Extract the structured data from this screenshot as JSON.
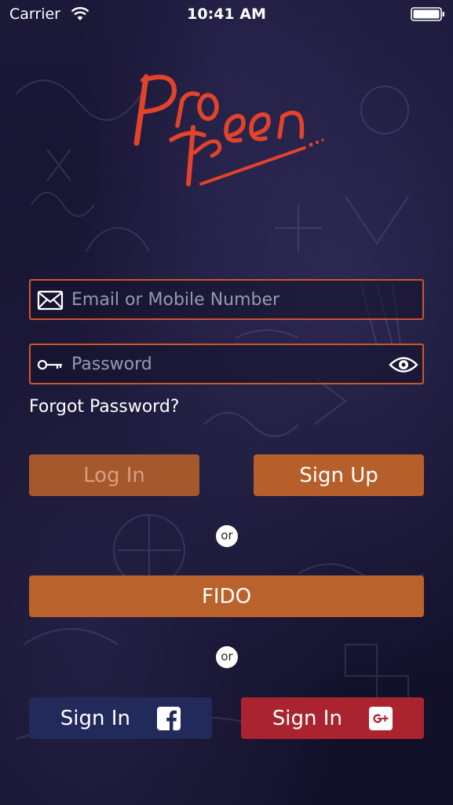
{
  "status_bar": {
    "carrier": "Carrier",
    "time": "10:41 AM"
  },
  "logo": {
    "text_top": "Pro",
    "text_bottom": "teen",
    "color": "#e2432a"
  },
  "login_form": {
    "email": {
      "placeholder": "Email or Mobile Number",
      "value": "",
      "icon": "envelope-icon"
    },
    "password": {
      "placeholder": "Password",
      "value": "",
      "icon": "key-icon",
      "toggle_icon": "eye-icon"
    },
    "forgot_password": "Forgot Password?"
  },
  "buttons": {
    "login": "Log In",
    "signup": "Sign Up",
    "fido": "FIDO",
    "facebook_signin": "Sign In",
    "google_signin": "Sign In"
  },
  "dividers": {
    "or_1": "or",
    "or_2": "or"
  },
  "colors": {
    "accent": "#b65f2a",
    "field_border": "#d0542c",
    "facebook": "#222a5c",
    "google": "#a9242e",
    "background": "#16142f"
  }
}
